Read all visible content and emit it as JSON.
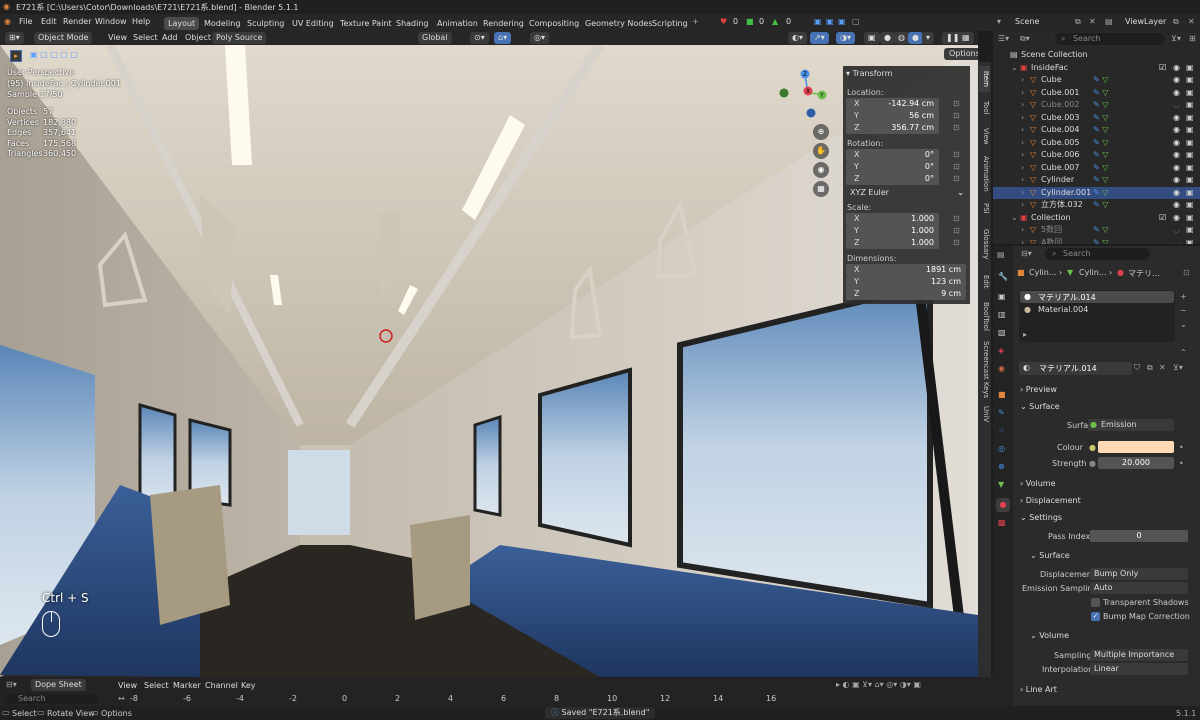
{
  "window": {
    "title": "E721系 [C:\\Users\\Cotor\\Downloads\\E721\\E721系.blend] - Blender 5.1.1"
  },
  "menu": [
    "File",
    "Edit",
    "Render",
    "Window",
    "Help"
  ],
  "workspaces": [
    {
      "label": "Layout",
      "active": true
    },
    {
      "label": "Modeling"
    },
    {
      "label": "Sculpting"
    },
    {
      "label": "UV Editing"
    },
    {
      "label": "Texture Paint"
    },
    {
      "label": "Shading"
    },
    {
      "label": "Animation"
    },
    {
      "label": "Rendering"
    },
    {
      "label": "Compositing"
    },
    {
      "label": "Geometry Nodes"
    },
    {
      "label": "Scripting"
    }
  ],
  "addWorkspace": "+",
  "counters": [
    "0",
    "0",
    "0"
  ],
  "scene": {
    "name": "Scene",
    "viewLayer": "ViewLayer"
  },
  "viewport": {
    "mode": "Object Mode",
    "menus": [
      "View",
      "Select",
      "Add",
      "Object"
    ],
    "polySource": "Poly Source",
    "orientation": "Global",
    "options": "Options",
    "overlay": {
      "perspective": "User Perspective",
      "object": "(95) InsideFac | Cylinder.001",
      "sample": "Sample 17/50"
    },
    "stats": [
      {
        "k": "Objects",
        "v": "57"
      },
      {
        "k": "Vertices",
        "v": "182,880"
      },
      {
        "k": "Edges",
        "v": "357,641"
      },
      {
        "k": "Faces",
        "v": "175,568"
      },
      {
        "k": "Triangles",
        "v": "360,450"
      }
    ],
    "shortcut": "Ctrl + S",
    "gizmo": {
      "x": "X",
      "y": "Y",
      "z": "Z"
    }
  },
  "npanel": {
    "title": "Transform",
    "location": {
      "label": "Location:",
      "x": "-142.94 cm",
      "y": "56 cm",
      "z": "356.77 cm"
    },
    "rotation": {
      "label": "Rotation:",
      "x": "0°",
      "y": "0°",
      "z": "0°"
    },
    "rotationMode": "XYZ Euler",
    "scale": {
      "label": "Scale:",
      "x": "1.000",
      "y": "1.000",
      "z": "1.000"
    },
    "dimensions": {
      "label": "Dimensions:",
      "x": "1891 cm",
      "y": "123 cm",
      "z": "9 cm"
    },
    "axes": [
      "X",
      "Y",
      "Z"
    ]
  },
  "sideTabs": [
    "Item",
    "Tool",
    "View",
    "Animation",
    "PSI",
    "Glossary",
    "Edit",
    "BoolTool",
    "Screencast Keys",
    "UniV"
  ],
  "outliner": {
    "search": "Search",
    "rows": [
      {
        "name": "Scene Collection",
        "indent": 0,
        "type": "scene"
      },
      {
        "name": "InsideFac",
        "indent": 1,
        "type": "coll"
      },
      {
        "name": "Cube",
        "indent": 2,
        "type": "obj"
      },
      {
        "name": "Cube.001",
        "indent": 2,
        "type": "obj"
      },
      {
        "name": "Cube.002",
        "indent": 2,
        "type": "obj",
        "dim": true
      },
      {
        "name": "Cube.003",
        "indent": 2,
        "type": "obj"
      },
      {
        "name": "Cube.004",
        "indent": 2,
        "type": "obj"
      },
      {
        "name": "Cube.005",
        "indent": 2,
        "type": "obj"
      },
      {
        "name": "Cube.006",
        "indent": 2,
        "type": "obj"
      },
      {
        "name": "Cube.007",
        "indent": 2,
        "type": "obj"
      },
      {
        "name": "Cylinder",
        "indent": 2,
        "type": "obj"
      },
      {
        "name": "Cylinder.001",
        "indent": 2,
        "type": "obj",
        "selected": true
      },
      {
        "name": "立方体.032",
        "indent": 2,
        "type": "obj"
      },
      {
        "name": "Collection",
        "indent": 1,
        "type": "coll"
      },
      {
        "name": "5数回",
        "indent": 2,
        "type": "obj",
        "dim": true
      },
      {
        "name": "A数回",
        "indent": 2,
        "type": "obj",
        "dim": true
      }
    ]
  },
  "properties": {
    "search": "Search",
    "breadcrumb": [
      "Cylin...",
      "Cylin...",
      "マテリ..."
    ],
    "slots": [
      {
        "name": "マテリアル.014",
        "selected": true
      },
      {
        "name": "Material.004"
      }
    ],
    "material": "マテリアル.014",
    "sections": {
      "preview": "Preview",
      "surface": "Surface",
      "volume": "Volume",
      "displacement": "Displacement",
      "settings": "Settings",
      "lineArt": "Line Art"
    },
    "surfaceLabel": "Surface",
    "surfaceValue": "Emission",
    "colourLabel": "Colour",
    "colourValue": "#ffd9b3",
    "strengthLabel": "Strength",
    "strengthValue": "20.000",
    "passIndexLabel": "Pass Index",
    "passIndexValue": "0",
    "subSurface": "Surface",
    "displacementLabel": "Displacement",
    "displacementValue": "Bump Only",
    "emissionSamplingLabel": "Emission Sampling",
    "emissionSamplingValue": "Auto",
    "transparentShadows": "Transparent Shadows",
    "bumpMap": "Bump Map Correction",
    "subVolume": "Volume",
    "samplingLabel": "Sampling",
    "samplingValue": "Multiple Importance",
    "interpolationLabel": "Interpolation",
    "interpolationValue": "Linear"
  },
  "timeline": {
    "editor": "Dope Sheet",
    "menus": [
      "View",
      "Select",
      "Marker",
      "Channel",
      "Key"
    ],
    "search": "Search",
    "ticks": [
      "-8",
      "-6",
      "-4",
      "-2",
      "0",
      "2",
      "4",
      "6",
      "8",
      "10",
      "12",
      "14",
      "16"
    ]
  },
  "status": {
    "select": "Select",
    "rotate": "Rotate View",
    "options": "Options",
    "message": "Saved \"E721系.blend\"",
    "version": "5.1.1"
  },
  "colors": {
    "accent": "#4772b3",
    "active": "#ffaf29",
    "orange": "#e0853a"
  }
}
